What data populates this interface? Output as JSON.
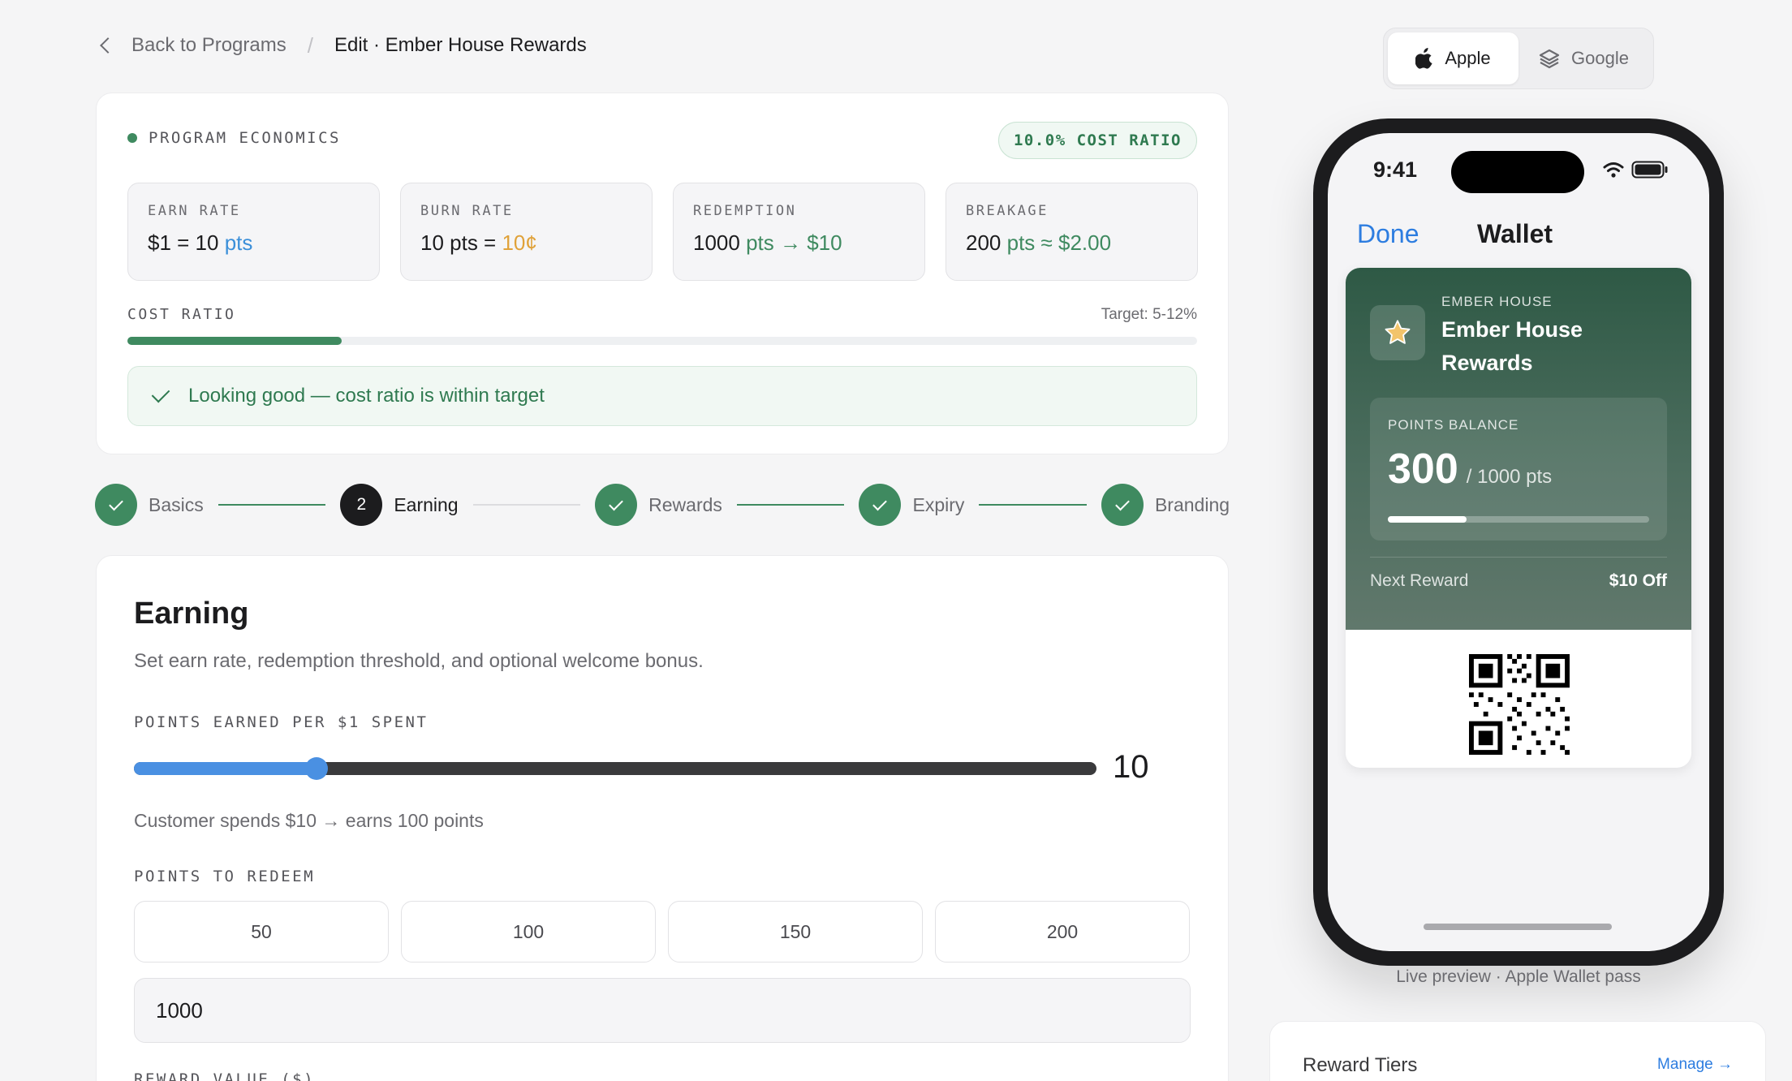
{
  "breadcrumb": {
    "back_label": "Back to Programs",
    "separator": "/",
    "current": "Edit · Ember House Rewards"
  },
  "economics": {
    "heading": "PROGRAM ECONOMICS",
    "ratio_badge": "10.0% COST RATIO",
    "metrics": [
      {
        "label": "EARN RATE",
        "a": "$1 = 10 ",
        "b": "pts",
        "c": ""
      },
      {
        "label": "BURN RATE",
        "a": "10 pts = ",
        "b": "10¢",
        "c": ""
      },
      {
        "label": "REDEMPTION",
        "a": "1000 ",
        "b": "pts → $10",
        "c": ""
      },
      {
        "label": "BREAKAGE",
        "a": "200 ",
        "b": "pts ≈ $2.00",
        "c": ""
      }
    ],
    "cost_ratio_label": "COST RATIO",
    "target": "Target: 5-12%",
    "cost_ratio_percent": 20,
    "status_message": "Looking good — cost ratio is within target"
  },
  "stepper": [
    {
      "label": "Basics",
      "state": "done",
      "number": ""
    },
    {
      "label": "Earning",
      "state": "active",
      "number": "2"
    },
    {
      "label": "Rewards",
      "state": "done",
      "number": ""
    },
    {
      "label": "Expiry",
      "state": "done",
      "number": ""
    },
    {
      "label": "Branding",
      "state": "done",
      "number": ""
    }
  ],
  "earning": {
    "title": "Earning",
    "description": "Set earn rate, redemption threshold, and optional welcome bonus.",
    "points_label": "POINTS EARNED PER $1 SPENT",
    "slider_value": "10",
    "slider_fraction": 0.19,
    "helper": "Customer spends $10 → earns 100 points",
    "redeem_label": "POINTS TO REDEEM",
    "redeem_options": [
      "50",
      "100",
      "150",
      "200"
    ],
    "redeem_value": "1000",
    "reward_value_label": "REWARD VALUE ($)"
  },
  "platform": {
    "options": [
      {
        "label": "Apple",
        "icon": "apple-icon",
        "selected": true
      },
      {
        "label": "Google",
        "icon": "layers-icon",
        "selected": false
      }
    ]
  },
  "phone": {
    "time": "9:41",
    "nav_done": "Done",
    "nav_title": "Wallet",
    "pass": {
      "org": "EMBER HOUSE",
      "name": "Ember House Rewards",
      "balance_label": "POINTS BALANCE",
      "balance": "300",
      "balance_of": "/ 1000 pts",
      "balance_fraction": 0.3,
      "next_reward_label": "Next Reward",
      "next_reward_value": "$10 Off",
      "logo_icon": "star-icon"
    }
  },
  "preview_caption": "Live preview · Apple Wallet pass",
  "tiers": {
    "title": "Reward Tiers",
    "link": "Manage →"
  },
  "colors": {
    "accent_green": "#3f8a60",
    "accent_blue": "#4a90e2",
    "pass_green": "#2e5945"
  }
}
